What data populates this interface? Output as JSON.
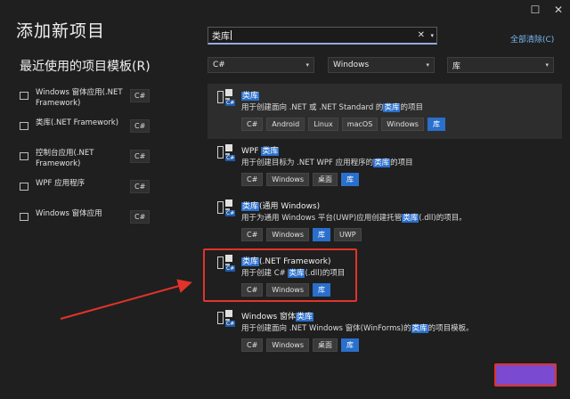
{
  "window": {
    "title": "添加新项目",
    "controls": [
      {
        "name": "maximize-button",
        "glyph": "☐"
      },
      {
        "name": "close-button",
        "glyph": "✕"
      }
    ]
  },
  "recent": {
    "heading": "最近使用的项目模板(R)",
    "items": [
      {
        "label": "Windows 窗体应用(.NET Framework)",
        "lang": "C#"
      },
      {
        "label": "类库(.NET Framework)",
        "lang": "C#"
      },
      {
        "label": "控制台应用(.NET Framework)",
        "lang": "C#"
      },
      {
        "label": "WPF 应用程序",
        "lang": "C#"
      },
      {
        "label": "Windows 窗体应用",
        "lang": "C#"
      }
    ]
  },
  "search": {
    "value": "类库",
    "clear_glyph": "✕",
    "dropdown_glyph": "▾"
  },
  "clear_all": "全部清除(C)",
  "filters": {
    "language": "C#",
    "platform": "Windows",
    "project_type": "库",
    "arrow_glyph": "▾"
  },
  "templates": [
    {
      "name_parts": [
        {
          "t": "类库",
          "hl": true
        }
      ],
      "desc_parts": [
        {
          "t": "用于创建面向 .NET 或 .NET Standard 的",
          "hl": false
        },
        {
          "t": "类库",
          "hl": true
        },
        {
          "t": "的项目",
          "hl": false
        }
      ],
      "tags": [
        {
          "t": "C#",
          "hl": false
        },
        {
          "t": "Android",
          "hl": false
        },
        {
          "t": "Linux",
          "hl": false
        },
        {
          "t": "macOS",
          "hl": false
        },
        {
          "t": "Windows",
          "hl": false
        },
        {
          "t": "库",
          "hl": true
        }
      ],
      "selected": true
    },
    {
      "name_parts": [
        {
          "t": "WPF ",
          "hl": false
        },
        {
          "t": "类库",
          "hl": true
        }
      ],
      "desc_parts": [
        {
          "t": "用于创建目标为 .NET WPF 应用程序的",
          "hl": false
        },
        {
          "t": "类库",
          "hl": true
        },
        {
          "t": "的项目",
          "hl": false
        }
      ],
      "tags": [
        {
          "t": "C#",
          "hl": false
        },
        {
          "t": "Windows",
          "hl": false
        },
        {
          "t": "桌面",
          "hl": false
        },
        {
          "t": "库",
          "hl": true
        }
      ],
      "selected": false
    },
    {
      "name_parts": [
        {
          "t": "类库",
          "hl": true
        },
        {
          "t": "(通用 Windows)",
          "hl": false
        }
      ],
      "desc_parts": [
        {
          "t": "用于为通用 Windows 平台(UWP)应用创建托管",
          "hl": false
        },
        {
          "t": "类库",
          "hl": true
        },
        {
          "t": "(.dll)的项目。",
          "hl": false
        }
      ],
      "tags": [
        {
          "t": "C#",
          "hl": false
        },
        {
          "t": "Windows",
          "hl": false
        },
        {
          "t": "库",
          "hl": true
        },
        {
          "t": "UWP",
          "hl": false
        }
      ],
      "selected": false
    },
    {
      "name_parts": [
        {
          "t": "类库",
          "hl": true
        },
        {
          "t": "(.NET Framework)",
          "hl": false
        }
      ],
      "desc_parts": [
        {
          "t": "用于创建 C# ",
          "hl": false
        },
        {
          "t": "类库",
          "hl": true
        },
        {
          "t": "(.dll)的项目",
          "hl": false
        }
      ],
      "tags": [
        {
          "t": "C#",
          "hl": false
        },
        {
          "t": "Windows",
          "hl": false
        },
        {
          "t": "库",
          "hl": true
        }
      ],
      "selected": false
    },
    {
      "name_parts": [
        {
          "t": "Windows 窗体",
          "hl": false
        },
        {
          "t": "类库",
          "hl": true
        }
      ],
      "desc_parts": [
        {
          "t": "用于创建面向 .NET Windows 窗体(WinForms)的",
          "hl": false
        },
        {
          "t": "类库",
          "hl": true
        },
        {
          "t": "的项目模板。",
          "hl": false
        }
      ],
      "tags": [
        {
          "t": "C#",
          "hl": false
        },
        {
          "t": "Windows",
          "hl": false
        },
        {
          "t": "桌面",
          "hl": false
        },
        {
          "t": "库",
          "hl": true
        }
      ],
      "selected": false
    }
  ],
  "colors": {
    "annotation_red": "#e0342a",
    "highlight_blue": "#2a6fcc",
    "next_button": "#7a4ad0"
  }
}
